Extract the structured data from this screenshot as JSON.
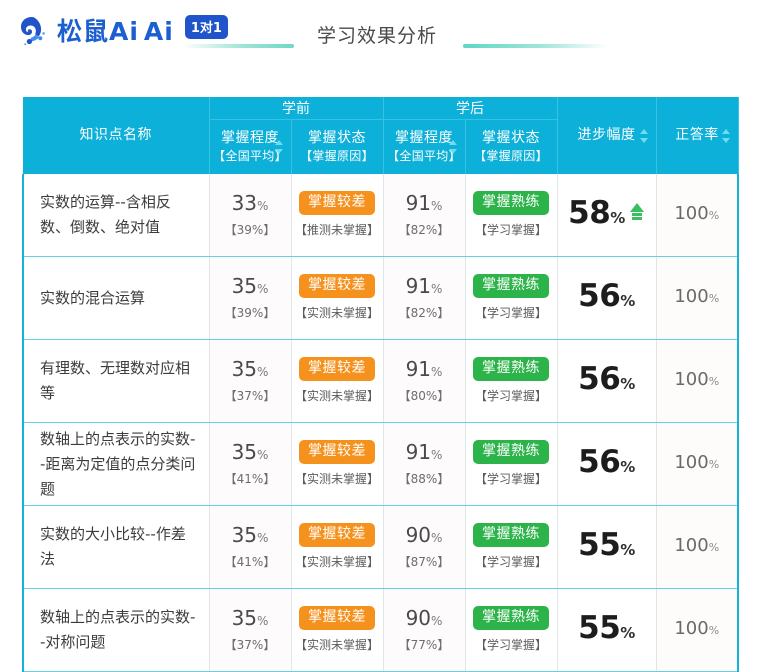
{
  "header": {
    "logo_text": "松鼠Ai",
    "logo_badge": "1对1",
    "logo_icon": "squirrel-icon",
    "title": "学习效果分析"
  },
  "table": {
    "group_headers": {
      "before": "学前",
      "after": "学后"
    },
    "columns": [
      {
        "key": "name",
        "label": "知识点名称",
        "sub": "",
        "sortable": false
      },
      {
        "key": "pre_level",
        "label": "掌握程度",
        "sub": "【全国平均】",
        "sortable": true
      },
      {
        "key": "pre_status",
        "label": "掌握状态",
        "sub": "【掌握原因】",
        "sortable": false
      },
      {
        "key": "post_level",
        "label": "掌握程度",
        "sub": "【全国平均】",
        "sortable": true
      },
      {
        "key": "post_status",
        "label": "掌握状态",
        "sub": "【掌握原因】",
        "sortable": false
      },
      {
        "key": "improve",
        "label": "进步幅度",
        "sub": "",
        "sortable": true
      },
      {
        "key": "accuracy",
        "label": "正答率",
        "sub": "",
        "sortable": true
      }
    ],
    "rows": [
      {
        "name": "实数的运算--含相反数、倒数、绝对值",
        "pre_pct": "33",
        "pre_unit": "%",
        "pre_avg": "【39%】",
        "pre_badge": "掌握较差",
        "pre_badge_type": "weak",
        "pre_reason": "【推测未掌握】",
        "post_pct": "91",
        "post_unit": "%",
        "post_avg": "【82%】",
        "post_badge": "掌握熟练",
        "post_badge_type": "good",
        "post_reason": "【学习掌握】",
        "improve": "58",
        "improve_unit": "%",
        "improve_arrow": "up-arrow-icon",
        "accuracy": "100",
        "accuracy_unit": "%"
      },
      {
        "name": "实数的混合运算",
        "pre_pct": "35",
        "pre_unit": "%",
        "pre_avg": "【39%】",
        "pre_badge": "掌握较差",
        "pre_badge_type": "weak",
        "pre_reason": "【实测未掌握】",
        "post_pct": "91",
        "post_unit": "%",
        "post_avg": "【82%】",
        "post_badge": "掌握熟练",
        "post_badge_type": "good",
        "post_reason": "【学习掌握】",
        "improve": "56",
        "improve_unit": "%",
        "improve_arrow": "",
        "accuracy": "100",
        "accuracy_unit": "%"
      },
      {
        "name": "有理数、无理数对应相等",
        "pre_pct": "35",
        "pre_unit": "%",
        "pre_avg": "【37%】",
        "pre_badge": "掌握较差",
        "pre_badge_type": "weak",
        "pre_reason": "【实测未掌握】",
        "post_pct": "91",
        "post_unit": "%",
        "post_avg": "【80%】",
        "post_badge": "掌握熟练",
        "post_badge_type": "good",
        "post_reason": "【学习掌握】",
        "improve": "56",
        "improve_unit": "%",
        "improve_arrow": "",
        "accuracy": "100",
        "accuracy_unit": "%"
      },
      {
        "name": "数轴上的点表示的实数--距离为定值的点分类问题",
        "pre_pct": "35",
        "pre_unit": "%",
        "pre_avg": "【41%】",
        "pre_badge": "掌握较差",
        "pre_badge_type": "weak",
        "pre_reason": "【实测未掌握】",
        "post_pct": "91",
        "post_unit": "%",
        "post_avg": "【88%】",
        "post_badge": "掌握熟练",
        "post_badge_type": "good",
        "post_reason": "【学习掌握】",
        "improve": "56",
        "improve_unit": "%",
        "improve_arrow": "",
        "accuracy": "100",
        "accuracy_unit": "%"
      },
      {
        "name": "实数的大小比较--作差法",
        "pre_pct": "35",
        "pre_unit": "%",
        "pre_avg": "【41%】",
        "pre_badge": "掌握较差",
        "pre_badge_type": "weak",
        "pre_reason": "【实测未掌握】",
        "post_pct": "90",
        "post_unit": "%",
        "post_avg": "【87%】",
        "post_badge": "掌握熟练",
        "post_badge_type": "good",
        "post_reason": "【学习掌握】",
        "improve": "55",
        "improve_unit": "%",
        "improve_arrow": "",
        "accuracy": "100",
        "accuracy_unit": "%"
      },
      {
        "name": "数轴上的点表示的实数--对称问题",
        "pre_pct": "35",
        "pre_unit": "%",
        "pre_avg": "【37%】",
        "pre_badge": "掌握较差",
        "pre_badge_type": "weak",
        "pre_reason": "【实测未掌握】",
        "post_pct": "90",
        "post_unit": "%",
        "post_avg": "【77%】",
        "post_badge": "掌握熟练",
        "post_badge_type": "good",
        "post_reason": "【学习掌握】",
        "improve": "55",
        "improve_unit": "%",
        "improve_arrow": "",
        "accuracy": "100",
        "accuracy_unit": "%"
      }
    ]
  },
  "colors": {
    "header_bg": "#0cb0d8",
    "badge_weak": "#f5921e",
    "badge_good": "#2cb34a",
    "accent_teal": "#6fd8c6",
    "logo_blue": "#1b5fd0",
    "arrow_green": "#39bf5f"
  }
}
